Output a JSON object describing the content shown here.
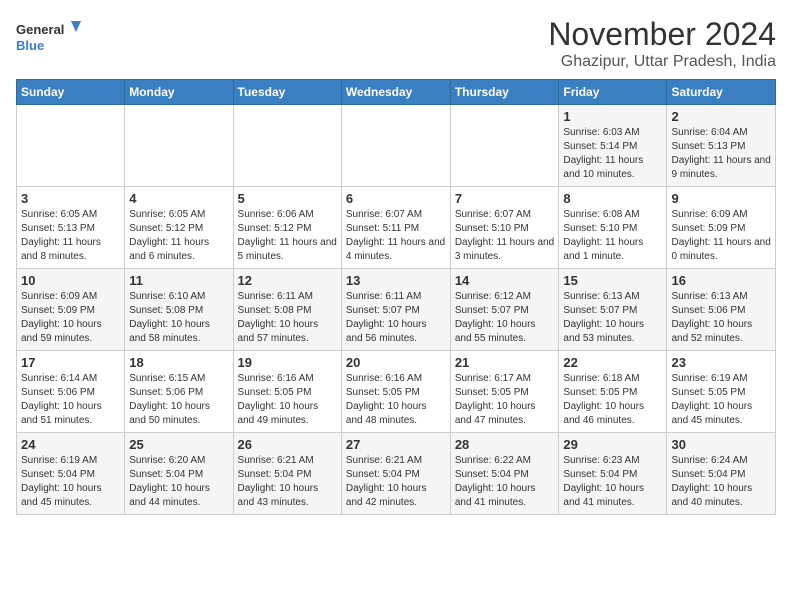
{
  "header": {
    "logo_line1": "General",
    "logo_line2": "Blue",
    "month_title": "November 2024",
    "location": "Ghazipur, Uttar Pradesh, India"
  },
  "weekdays": [
    "Sunday",
    "Monday",
    "Tuesday",
    "Wednesday",
    "Thursday",
    "Friday",
    "Saturday"
  ],
  "weeks": [
    [
      {
        "day": "",
        "info": ""
      },
      {
        "day": "",
        "info": ""
      },
      {
        "day": "",
        "info": ""
      },
      {
        "day": "",
        "info": ""
      },
      {
        "day": "",
        "info": ""
      },
      {
        "day": "1",
        "info": "Sunrise: 6:03 AM\nSunset: 5:14 PM\nDaylight: 11 hours and 10 minutes."
      },
      {
        "day": "2",
        "info": "Sunrise: 6:04 AM\nSunset: 5:13 PM\nDaylight: 11 hours and 9 minutes."
      }
    ],
    [
      {
        "day": "3",
        "info": "Sunrise: 6:05 AM\nSunset: 5:13 PM\nDaylight: 11 hours and 8 minutes."
      },
      {
        "day": "4",
        "info": "Sunrise: 6:05 AM\nSunset: 5:12 PM\nDaylight: 11 hours and 6 minutes."
      },
      {
        "day": "5",
        "info": "Sunrise: 6:06 AM\nSunset: 5:12 PM\nDaylight: 11 hours and 5 minutes."
      },
      {
        "day": "6",
        "info": "Sunrise: 6:07 AM\nSunset: 5:11 PM\nDaylight: 11 hours and 4 minutes."
      },
      {
        "day": "7",
        "info": "Sunrise: 6:07 AM\nSunset: 5:10 PM\nDaylight: 11 hours and 3 minutes."
      },
      {
        "day": "8",
        "info": "Sunrise: 6:08 AM\nSunset: 5:10 PM\nDaylight: 11 hours and 1 minute."
      },
      {
        "day": "9",
        "info": "Sunrise: 6:09 AM\nSunset: 5:09 PM\nDaylight: 11 hours and 0 minutes."
      }
    ],
    [
      {
        "day": "10",
        "info": "Sunrise: 6:09 AM\nSunset: 5:09 PM\nDaylight: 10 hours and 59 minutes."
      },
      {
        "day": "11",
        "info": "Sunrise: 6:10 AM\nSunset: 5:08 PM\nDaylight: 10 hours and 58 minutes."
      },
      {
        "day": "12",
        "info": "Sunrise: 6:11 AM\nSunset: 5:08 PM\nDaylight: 10 hours and 57 minutes."
      },
      {
        "day": "13",
        "info": "Sunrise: 6:11 AM\nSunset: 5:07 PM\nDaylight: 10 hours and 56 minutes."
      },
      {
        "day": "14",
        "info": "Sunrise: 6:12 AM\nSunset: 5:07 PM\nDaylight: 10 hours and 55 minutes."
      },
      {
        "day": "15",
        "info": "Sunrise: 6:13 AM\nSunset: 5:07 PM\nDaylight: 10 hours and 53 minutes."
      },
      {
        "day": "16",
        "info": "Sunrise: 6:13 AM\nSunset: 5:06 PM\nDaylight: 10 hours and 52 minutes."
      }
    ],
    [
      {
        "day": "17",
        "info": "Sunrise: 6:14 AM\nSunset: 5:06 PM\nDaylight: 10 hours and 51 minutes."
      },
      {
        "day": "18",
        "info": "Sunrise: 6:15 AM\nSunset: 5:06 PM\nDaylight: 10 hours and 50 minutes."
      },
      {
        "day": "19",
        "info": "Sunrise: 6:16 AM\nSunset: 5:05 PM\nDaylight: 10 hours and 49 minutes."
      },
      {
        "day": "20",
        "info": "Sunrise: 6:16 AM\nSunset: 5:05 PM\nDaylight: 10 hours and 48 minutes."
      },
      {
        "day": "21",
        "info": "Sunrise: 6:17 AM\nSunset: 5:05 PM\nDaylight: 10 hours and 47 minutes."
      },
      {
        "day": "22",
        "info": "Sunrise: 6:18 AM\nSunset: 5:05 PM\nDaylight: 10 hours and 46 minutes."
      },
      {
        "day": "23",
        "info": "Sunrise: 6:19 AM\nSunset: 5:05 PM\nDaylight: 10 hours and 45 minutes."
      }
    ],
    [
      {
        "day": "24",
        "info": "Sunrise: 6:19 AM\nSunset: 5:04 PM\nDaylight: 10 hours and 45 minutes."
      },
      {
        "day": "25",
        "info": "Sunrise: 6:20 AM\nSunset: 5:04 PM\nDaylight: 10 hours and 44 minutes."
      },
      {
        "day": "26",
        "info": "Sunrise: 6:21 AM\nSunset: 5:04 PM\nDaylight: 10 hours and 43 minutes."
      },
      {
        "day": "27",
        "info": "Sunrise: 6:21 AM\nSunset: 5:04 PM\nDaylight: 10 hours and 42 minutes."
      },
      {
        "day": "28",
        "info": "Sunrise: 6:22 AM\nSunset: 5:04 PM\nDaylight: 10 hours and 41 minutes."
      },
      {
        "day": "29",
        "info": "Sunrise: 6:23 AM\nSunset: 5:04 PM\nDaylight: 10 hours and 41 minutes."
      },
      {
        "day": "30",
        "info": "Sunrise: 6:24 AM\nSunset: 5:04 PM\nDaylight: 10 hours and 40 minutes."
      }
    ]
  ]
}
